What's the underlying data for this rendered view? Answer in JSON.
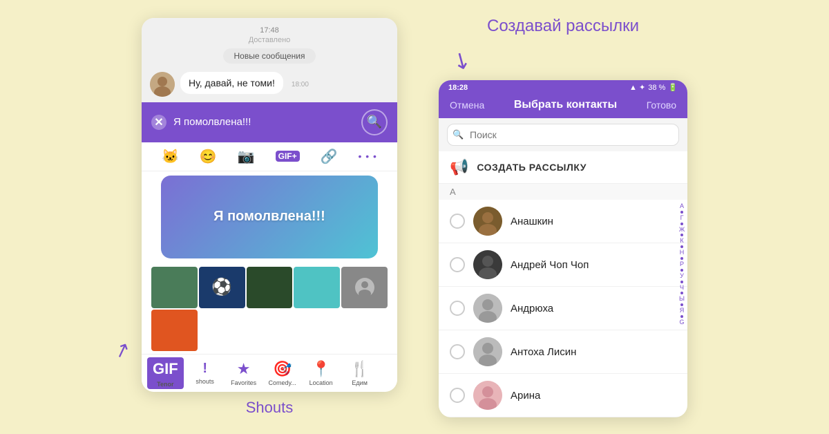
{
  "background": "#f5f0c8",
  "left": {
    "caption": "Shouts",
    "chat": {
      "time": "17:48",
      "delivered": "Доставлено",
      "new_messages_pill": "Новые сообщения",
      "incoming_message": "Ну, давай, не томи!",
      "incoming_time": "18:00",
      "typing_text": "Я помолвлена!!!",
      "sticker_text": "Я помолвлена!!!"
    },
    "icons": [
      "🐱",
      "😊",
      "📷",
      "GIF+",
      "🔗",
      "•••"
    ],
    "tabs": [
      {
        "id": "tenor",
        "icon": "GIF",
        "label": "Tenor"
      },
      {
        "id": "shouts",
        "icon": "!",
        "label": "shouts"
      },
      {
        "id": "favorites",
        "icon": "★",
        "label": "Favorites"
      },
      {
        "id": "comedy",
        "icon": "🎯",
        "label": "Comedy..."
      },
      {
        "id": "location",
        "icon": "📍",
        "label": "Location"
      },
      {
        "id": "edim",
        "icon": "🍴",
        "label": "Едим"
      }
    ]
  },
  "right": {
    "caption": "Создавай рассылки",
    "status_bar": {
      "time": "18:28",
      "signal": "▲ ✦",
      "battery": "38 %"
    },
    "header": {
      "cancel": "Отмена",
      "title": "Выбрать контакты",
      "done": "Готово"
    },
    "search_placeholder": "Поиск",
    "broadcast_label": "СОЗДАТЬ РАССЫЛКУ",
    "section_a": "А",
    "contacts": [
      {
        "name": "Анашкин",
        "avatar_type": "photo1"
      },
      {
        "name": "Андрей Чоп Чоп",
        "avatar_type": "photo2"
      },
      {
        "name": "Андрюха",
        "avatar_type": "gray"
      },
      {
        "name": "Антоха Лисин",
        "avatar_type": "gray"
      },
      {
        "name": "Арина",
        "avatar_type": "photo3"
      }
    ],
    "alphabet": [
      "А",
      "Г",
      "Ж",
      "К",
      "Н",
      "Р",
      "У",
      "Ч",
      "Ы",
      "Я",
      "G"
    ]
  }
}
